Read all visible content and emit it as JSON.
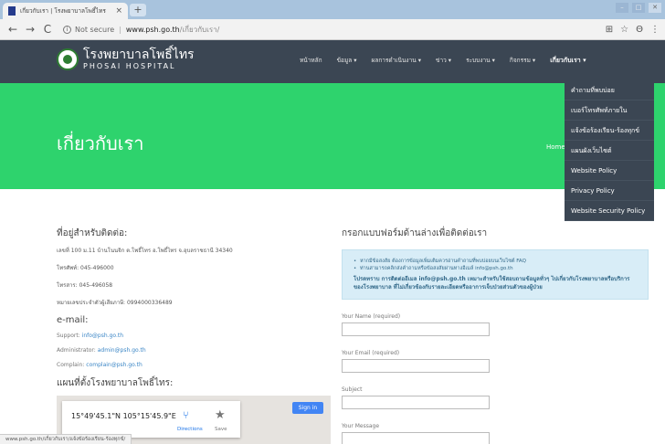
{
  "browser": {
    "tab_title": "เกี่ยวกับเรา | โรงพยาบาลโพธิ์ไทร",
    "tab_close": "×",
    "new_tab": "+",
    "nav": {
      "back": "←",
      "forward": "→",
      "reload": "C"
    },
    "security_label": "Not secure",
    "url_host": "www.psh.go.th",
    "url_path": "/เกี่ยวกับเรา/",
    "status_url": "www.psh.go.th/เกี่ยวกับเรา/แจ้งข้อร้องเรียน-ร้องทุกข์/"
  },
  "site": {
    "logo_th": "โรงพยาบาลโพธิ์ไทร",
    "logo_en": "PHOSAI HOSPITAL",
    "menu": [
      {
        "label": "หน้าหลัก"
      },
      {
        "label": "ข้อมูล ▾"
      },
      {
        "label": "ผลการดำเนินงาน ▾"
      },
      {
        "label": "ข่าว ▾"
      },
      {
        "label": "ระบบงาน ▾"
      },
      {
        "label": "กิจกรรม ▾"
      },
      {
        "label": "เกี่ยวกับเรา ▾"
      }
    ],
    "dropdown": [
      {
        "label": "คำถามที่พบบ่อย"
      },
      {
        "label": "เบอร์โทรศัพท์ภายใน"
      },
      {
        "label": "แจ้งข้อร้องเรียน-ร้องทุกข์"
      },
      {
        "label": "แผนผังเว็บไซต์"
      },
      {
        "label": "Website Policy"
      },
      {
        "label": "Privacy Policy"
      },
      {
        "label": "Website Security Policy"
      }
    ]
  },
  "banner": {
    "title": "เกี่ยวกับเรา",
    "crumb": "Home"
  },
  "contact": {
    "heading": "ที่อยู่สำหรับติดต่อ:",
    "address": "เลขที่ 100 ม.11 บ้านโนนจิก ต.โพธิ์ไทร อ.โพธิ์ไทร จ.อุบลราชธานี 34340",
    "phone": "โทรศัพท์: 045-496000",
    "fax": "โทรสาร: 045-496058",
    "taxid": "หมายเลขประจำตัวผู้เสียภาษี: 0994000336489",
    "email_heading": "e-mail:",
    "support_label": "Support:",
    "support_email": "info@psh.go.th",
    "admin_label": "Administrator:",
    "admin_email": "admin@psh.go.th",
    "complain_label": "Complain:",
    "complain_email": "complain@psh.go.th",
    "map_title": "แผนที่ตั้งโรงพยาบาลโพธิ์ไทร:"
  },
  "map": {
    "coord": "15°49'45.1\"N 105°15'45.9\"E",
    "directions": "Directions",
    "save": "Save",
    "signin": "Sign in"
  },
  "form": {
    "heading": "กรอกแบบฟอร์มด้านล่างเพื่อติดต่อเรา",
    "bullet1": "หากมีข้อสงสัย ต้องการข้อมูลเพิ่มเติมควรอ่านคำถามที่พบบ่อยบนเว็บไซต์ FAQ",
    "bullet2": "ท่านสามารถคลิกส่งคำถามหรือข้อสงสัยผ่านทางอีเมล์ info@psh.go.th",
    "note": "โปรดทราบ การติดต่ออีเมล info@psh.go.th เหมาะสำหรับใช้สอบถามข้อมูลทั่วๆ ไปเกี่ยวกับโรงพยาบาลหรือบริการของโรงพยาบาล ที่ไม่เกี่ยวข้องกับรายละเอียดหรืออาการเจ็บป่วยส่วนตัวของผู้ป่วย",
    "name_label": "Your Name (required)",
    "email_label": "Your Email (required)",
    "subject_label": "Subject",
    "message_label": "Your Message"
  }
}
